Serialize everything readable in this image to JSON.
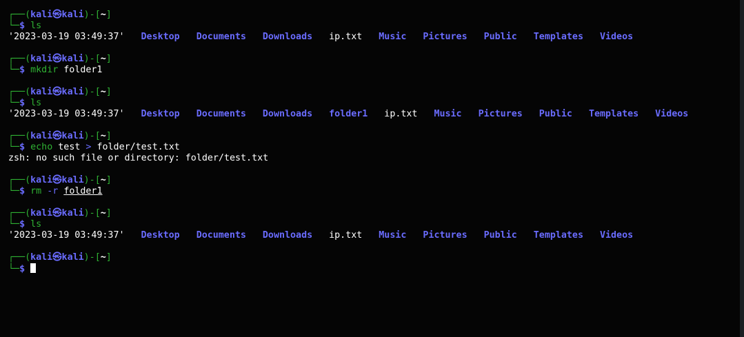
{
  "colors": {
    "background": "#050505",
    "frame_green": "#2fb233",
    "user_blue": "#6a6cff",
    "directory_blue": "#6a6cff",
    "text": "#ffffff"
  },
  "prompt": {
    "top_open": "┌──(",
    "user": "kali",
    "at_symbol": "㉿",
    "host": "kali",
    "close_bracket": ")-[",
    "cwd": "~",
    "end_bracket": "]",
    "bottom": "└─",
    "symbol": "$"
  },
  "blocks": [
    {
      "command": "ls",
      "args": "",
      "output_ls": [
        {
          "name": "'2023-03-19 03:49:37'",
          "type": "file"
        },
        {
          "name": "Desktop",
          "type": "dir"
        },
        {
          "name": "Documents",
          "type": "dir"
        },
        {
          "name": "Downloads",
          "type": "dir"
        },
        {
          "name": "ip.txt",
          "type": "file"
        },
        {
          "name": "Music",
          "type": "dir"
        },
        {
          "name": "Pictures",
          "type": "dir"
        },
        {
          "name": "Public",
          "type": "dir"
        },
        {
          "name": "Templates",
          "type": "dir"
        },
        {
          "name": "Videos",
          "type": "dir"
        }
      ]
    },
    {
      "command": "mkdir",
      "args": "folder1"
    },
    {
      "command": "ls",
      "args": "",
      "output_ls": [
        {
          "name": "'2023-03-19 03:49:37'",
          "type": "file"
        },
        {
          "name": "Desktop",
          "type": "dir"
        },
        {
          "name": "Documents",
          "type": "dir"
        },
        {
          "name": "Downloads",
          "type": "dir"
        },
        {
          "name": "folder1",
          "type": "dir"
        },
        {
          "name": "ip.txt",
          "type": "file"
        },
        {
          "name": "Music",
          "type": "dir"
        },
        {
          "name": "Pictures",
          "type": "dir"
        },
        {
          "name": "Public",
          "type": "dir"
        },
        {
          "name": "Templates",
          "type": "dir"
        },
        {
          "name": "Videos",
          "type": "dir"
        }
      ]
    },
    {
      "command": "echo",
      "args_parts": [
        "test",
        ">",
        "folder/test.txt"
      ],
      "output_text": "zsh: no such file or directory: folder/test.txt"
    },
    {
      "command": "rm",
      "args_parts": [
        "-r",
        "folder1"
      ]
    },
    {
      "command": "ls",
      "args": "",
      "output_ls": [
        {
          "name": "'2023-03-19 03:49:37'",
          "type": "file"
        },
        {
          "name": "Desktop",
          "type": "dir"
        },
        {
          "name": "Documents",
          "type": "dir"
        },
        {
          "name": "Downloads",
          "type": "dir"
        },
        {
          "name": "ip.txt",
          "type": "file"
        },
        {
          "name": "Music",
          "type": "dir"
        },
        {
          "name": "Pictures",
          "type": "dir"
        },
        {
          "name": "Public",
          "type": "dir"
        },
        {
          "name": "Templates",
          "type": "dir"
        },
        {
          "name": "Videos",
          "type": "dir"
        }
      ]
    }
  ]
}
